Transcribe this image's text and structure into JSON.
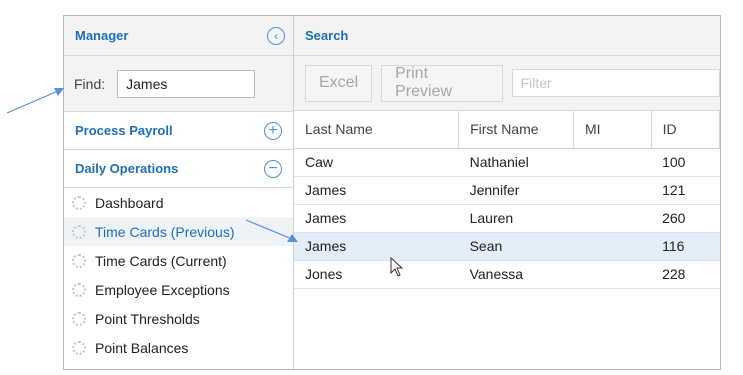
{
  "manager": {
    "title": "Manager",
    "collapse_icon": "chevron-left-icon"
  },
  "search": {
    "title": "Search"
  },
  "find": {
    "label": "Find:",
    "value": "James"
  },
  "sections": {
    "process_payroll": {
      "title": "Process Payroll",
      "icon": "plus-circle-icon"
    },
    "daily_operations": {
      "title": "Daily Operations",
      "icon": "minus-circle-icon"
    }
  },
  "nav_items": [
    {
      "label": "Dashboard",
      "active": false
    },
    {
      "label": "Time Cards (Previous)",
      "active": true
    },
    {
      "label": "Time Cards (Current)",
      "active": false
    },
    {
      "label": "Employee Exceptions",
      "active": false
    },
    {
      "label": "Point Thresholds",
      "active": false
    },
    {
      "label": "Point Balances",
      "active": false
    }
  ],
  "toolbar": {
    "excel_label": "Excel",
    "print_preview_label": "Print Preview",
    "filter_placeholder": "Filter"
  },
  "table": {
    "columns": [
      "Last Name",
      "First Name",
      "MI",
      "ID"
    ],
    "rows": [
      {
        "last": "Caw",
        "first": "Nathaniel",
        "mi": "",
        "id": "100"
      },
      {
        "last": "James",
        "first": "Jennifer",
        "mi": "",
        "id": "121"
      },
      {
        "last": "James",
        "first": "Lauren",
        "mi": "",
        "id": "260"
      },
      {
        "last": "James",
        "first": "Sean",
        "mi": "",
        "id": "116",
        "selected": true
      },
      {
        "last": "Jones",
        "first": "Vanessa",
        "mi": "",
        "id": "228"
      }
    ]
  },
  "colors": {
    "accent": "#1f6fb5",
    "selection": "#e3eef8",
    "arrow": "#5b8fd6"
  }
}
